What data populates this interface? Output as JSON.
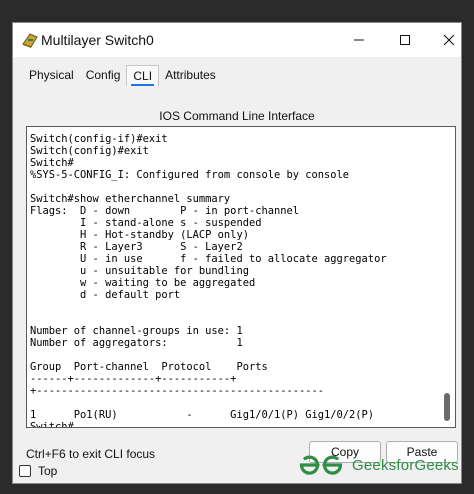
{
  "window": {
    "title": "Multilayer Switch0"
  },
  "tabs": [
    {
      "label": "Physical"
    },
    {
      "label": "Config"
    },
    {
      "label": "CLI"
    },
    {
      "label": "Attributes"
    }
  ],
  "panel": {
    "title": "IOS Command Line Interface"
  },
  "cli": {
    "text": "Switch(config-if)#exit\nSwitch(config)#exit\nSwitch#\n%SYS-5-CONFIG_I: Configured from console by console\n\nSwitch#show etherchannel summary\nFlags:  D - down        P - in port-channel\n        I - stand-alone s - suspended\n        H - Hot-standby (LACP only)\n        R - Layer3      S - Layer2\n        U - in use      f - failed to allocate aggregator\n        u - unsuitable for bundling\n        w - waiting to be aggregated\n        d - default port\n\n\nNumber of channel-groups in use: 1\nNumber of aggregators:           1\n\nGroup  Port-channel  Protocol    Ports\n------+-------------+-----------+\n+----------------------------------------------\n\n1      Po1(RU)           -      Gig1/0/1(P) Gig1/0/2(P)\nSwitch#"
  },
  "footer": {
    "hint": "Ctrl+F6 to exit CLI focus",
    "copy_label": "Copy",
    "paste_label": "Paste",
    "top_label": "Top"
  },
  "watermark": {
    "text": "GeeksforGeeks",
    "color": "#2f8d46"
  },
  "icons": {
    "app": "switch-icon",
    "minimize": "minimize-icon",
    "maximize": "maximize-icon",
    "close": "close-icon"
  }
}
